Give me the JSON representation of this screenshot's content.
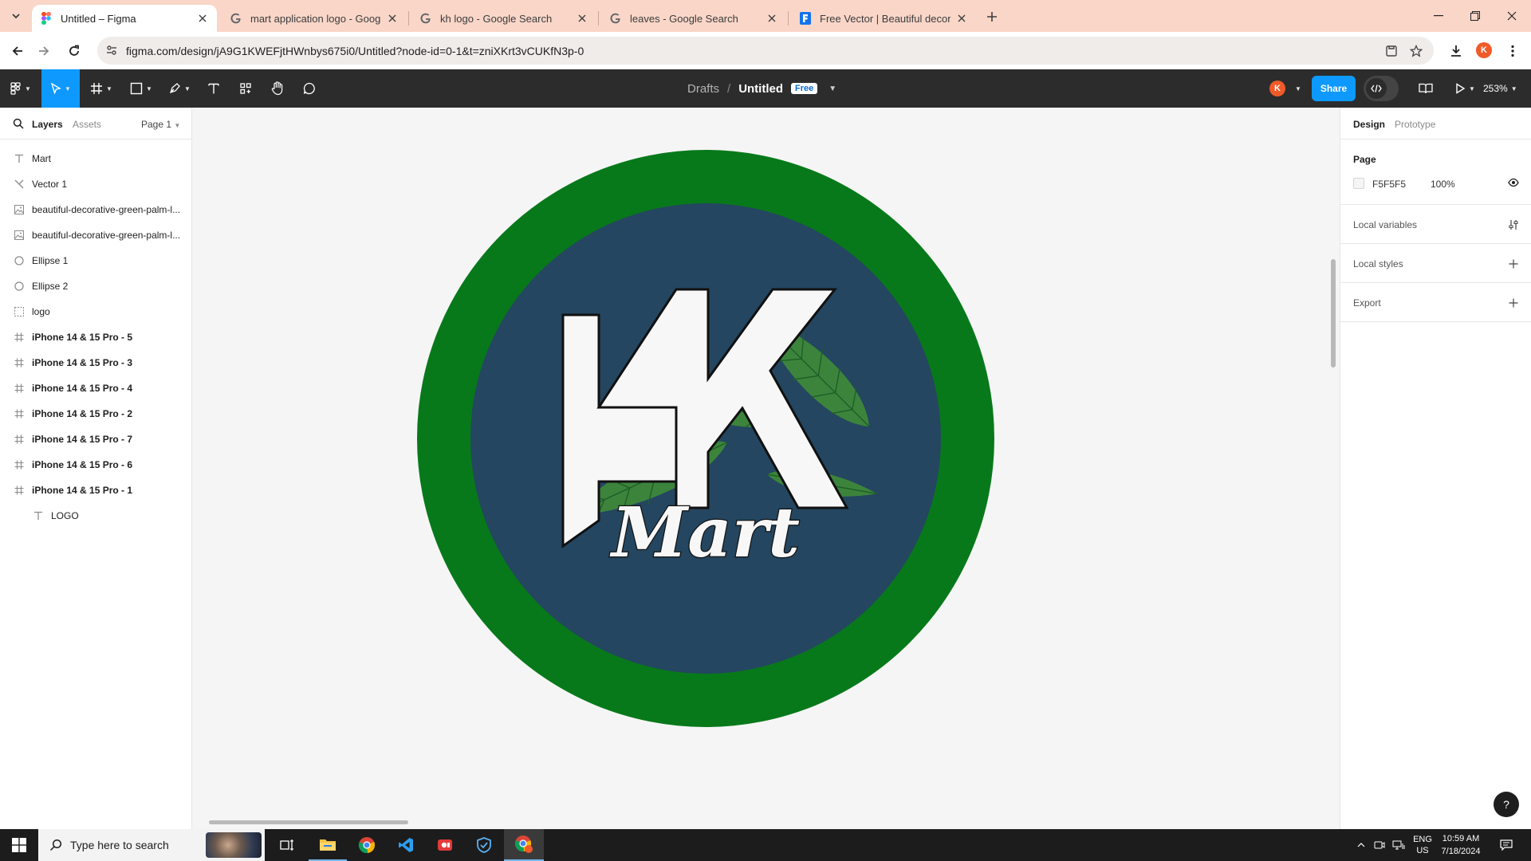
{
  "browser": {
    "tabs": [
      {
        "title": "Untitled – Figma",
        "favicon": "figma-icon",
        "active": true
      },
      {
        "title": "mart application logo - Google",
        "favicon": "google-icon",
        "active": false
      },
      {
        "title": "kh logo - Google Search",
        "favicon": "google-icon",
        "active": false
      },
      {
        "title": "leaves - Google Search",
        "favicon": "google-icon",
        "active": false
      },
      {
        "title": "Free Vector | Beautiful decorativ",
        "favicon": "freepik-icon",
        "active": false
      }
    ],
    "url": "figma.com/design/jA9G1KWEFjtHWnbys675i0/Untitled?node-id=0-1&t=zniXKrt3vCUKfN3p-0",
    "profile_initial": "K"
  },
  "figma_toolbar": {
    "breadcrumb_drafts": "Drafts",
    "breadcrumb_sep": "/",
    "file_name": "Untitled",
    "plan_badge": "Free",
    "user_initial": "K",
    "share_label": "Share",
    "zoom": "253%"
  },
  "layers_panel": {
    "tab_layers": "Layers",
    "tab_assets": "Assets",
    "page_selector": "Page 1",
    "layers": [
      {
        "name": "Mart",
        "icon": "text-icon",
        "frame": false,
        "indent": false
      },
      {
        "name": "Vector 1",
        "icon": "vector-icon",
        "frame": false,
        "indent": false
      },
      {
        "name": "beautiful-decorative-green-palm-l...",
        "icon": "image-icon",
        "frame": false,
        "indent": false
      },
      {
        "name": "beautiful-decorative-green-palm-l...",
        "icon": "image-icon",
        "frame": false,
        "indent": false
      },
      {
        "name": "Ellipse 1",
        "icon": "ellipse-icon",
        "frame": false,
        "indent": false
      },
      {
        "name": "Ellipse 2",
        "icon": "ellipse-icon",
        "frame": false,
        "indent": false
      },
      {
        "name": "logo",
        "icon": "section-icon",
        "frame": false,
        "indent": false
      },
      {
        "name": "iPhone 14 & 15 Pro - 5",
        "icon": "frame-icon",
        "frame": true,
        "indent": false
      },
      {
        "name": "iPhone 14 & 15 Pro - 3",
        "icon": "frame-icon",
        "frame": true,
        "indent": false
      },
      {
        "name": "iPhone 14 & 15 Pro - 4",
        "icon": "frame-icon",
        "frame": true,
        "indent": false
      },
      {
        "name": "iPhone 14 & 15 Pro - 2",
        "icon": "frame-icon",
        "frame": true,
        "indent": false
      },
      {
        "name": "iPhone 14 & 15 Pro - 7",
        "icon": "frame-icon",
        "frame": true,
        "indent": false
      },
      {
        "name": "iPhone 14 & 15 Pro - 6",
        "icon": "frame-icon",
        "frame": true,
        "indent": false
      },
      {
        "name": "iPhone 14 & 15 Pro - 1",
        "icon": "frame-icon",
        "frame": true,
        "indent": false
      },
      {
        "name": "LOGO",
        "icon": "text-icon",
        "frame": false,
        "indent": true
      }
    ]
  },
  "canvas": {
    "logo_text": "Mart",
    "colors": {
      "canvas_bg": "#F5F5F5",
      "outer_ring": "#07791A",
      "inner_disc": "#244660",
      "letters": "#F7F7F7",
      "leaf": "#3F8A3A"
    }
  },
  "design_panel": {
    "tab_design": "Design",
    "tab_prototype": "Prototype",
    "page_title": "Page",
    "page_color": "F5F5F5",
    "page_opacity": "100%",
    "local_variables": "Local variables",
    "local_styles": "Local styles",
    "export": "Export",
    "help": "?"
  },
  "taskbar": {
    "search_placeholder": "Type here to search",
    "lang_top": "ENG",
    "lang_bottom": "US",
    "time": "10:59 AM",
    "date": "7/18/2024"
  }
}
